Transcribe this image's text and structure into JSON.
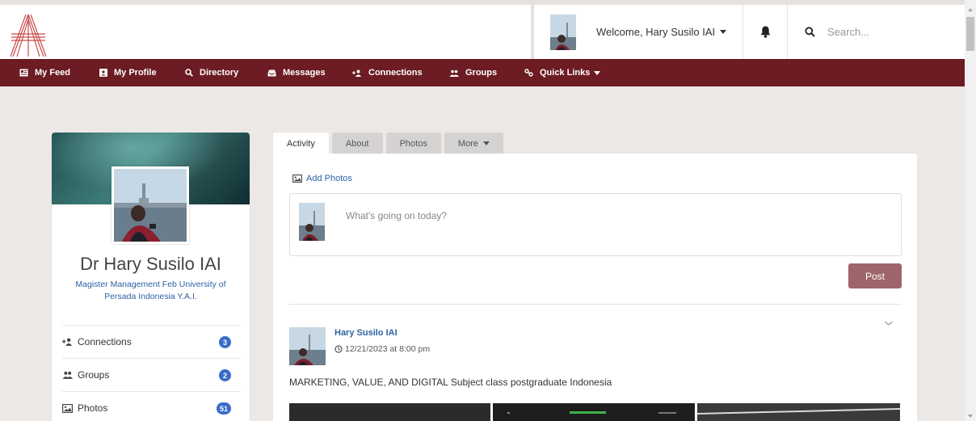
{
  "header": {
    "welcome_text": "Welcome, Hary Susilo IAI",
    "search_placeholder": "Search..."
  },
  "nav": {
    "items": [
      {
        "label": "My Feed",
        "icon": "feed-icon"
      },
      {
        "label": "My Profile",
        "icon": "id-card-icon"
      },
      {
        "label": "Directory",
        "icon": "search-icon"
      },
      {
        "label": "Messages",
        "icon": "inbox-icon"
      },
      {
        "label": "Connections",
        "icon": "user-plus-icon"
      },
      {
        "label": "Groups",
        "icon": "users-icon"
      },
      {
        "label": "Quick Links",
        "icon": "link-icon"
      }
    ]
  },
  "profile": {
    "name": "Dr Hary Susilo IAI",
    "subtitle": "Magister Management Feb University of Persada Indonesia Y.A.I.",
    "side_items": [
      {
        "label": "Connections",
        "count": "3",
        "icon": "user-plus-icon"
      },
      {
        "label": "Groups",
        "count": "2",
        "icon": "users-icon"
      },
      {
        "label": "Photos",
        "count": "51",
        "icon": "image-icon"
      }
    ]
  },
  "tabs": [
    {
      "label": "Activity",
      "active": true
    },
    {
      "label": "About",
      "active": false
    },
    {
      "label": "Photos",
      "active": false
    },
    {
      "label": "More",
      "active": false
    }
  ],
  "composer": {
    "add_photos_label": "Add Photos",
    "placeholder": "What's going on today?",
    "post_label": "Post"
  },
  "post": {
    "author": "Hary Susilo IAI",
    "timestamp": "12/21/2023 at 8:00 pm",
    "text": "MARKETING, VALUE, AND DIGITAL Subject class postgraduate Indonesia"
  },
  "colors": {
    "nav_bg": "#6c1c22",
    "link": "#2d63a3",
    "badge": "#3a6cc9",
    "post_button": "#9e656a"
  }
}
